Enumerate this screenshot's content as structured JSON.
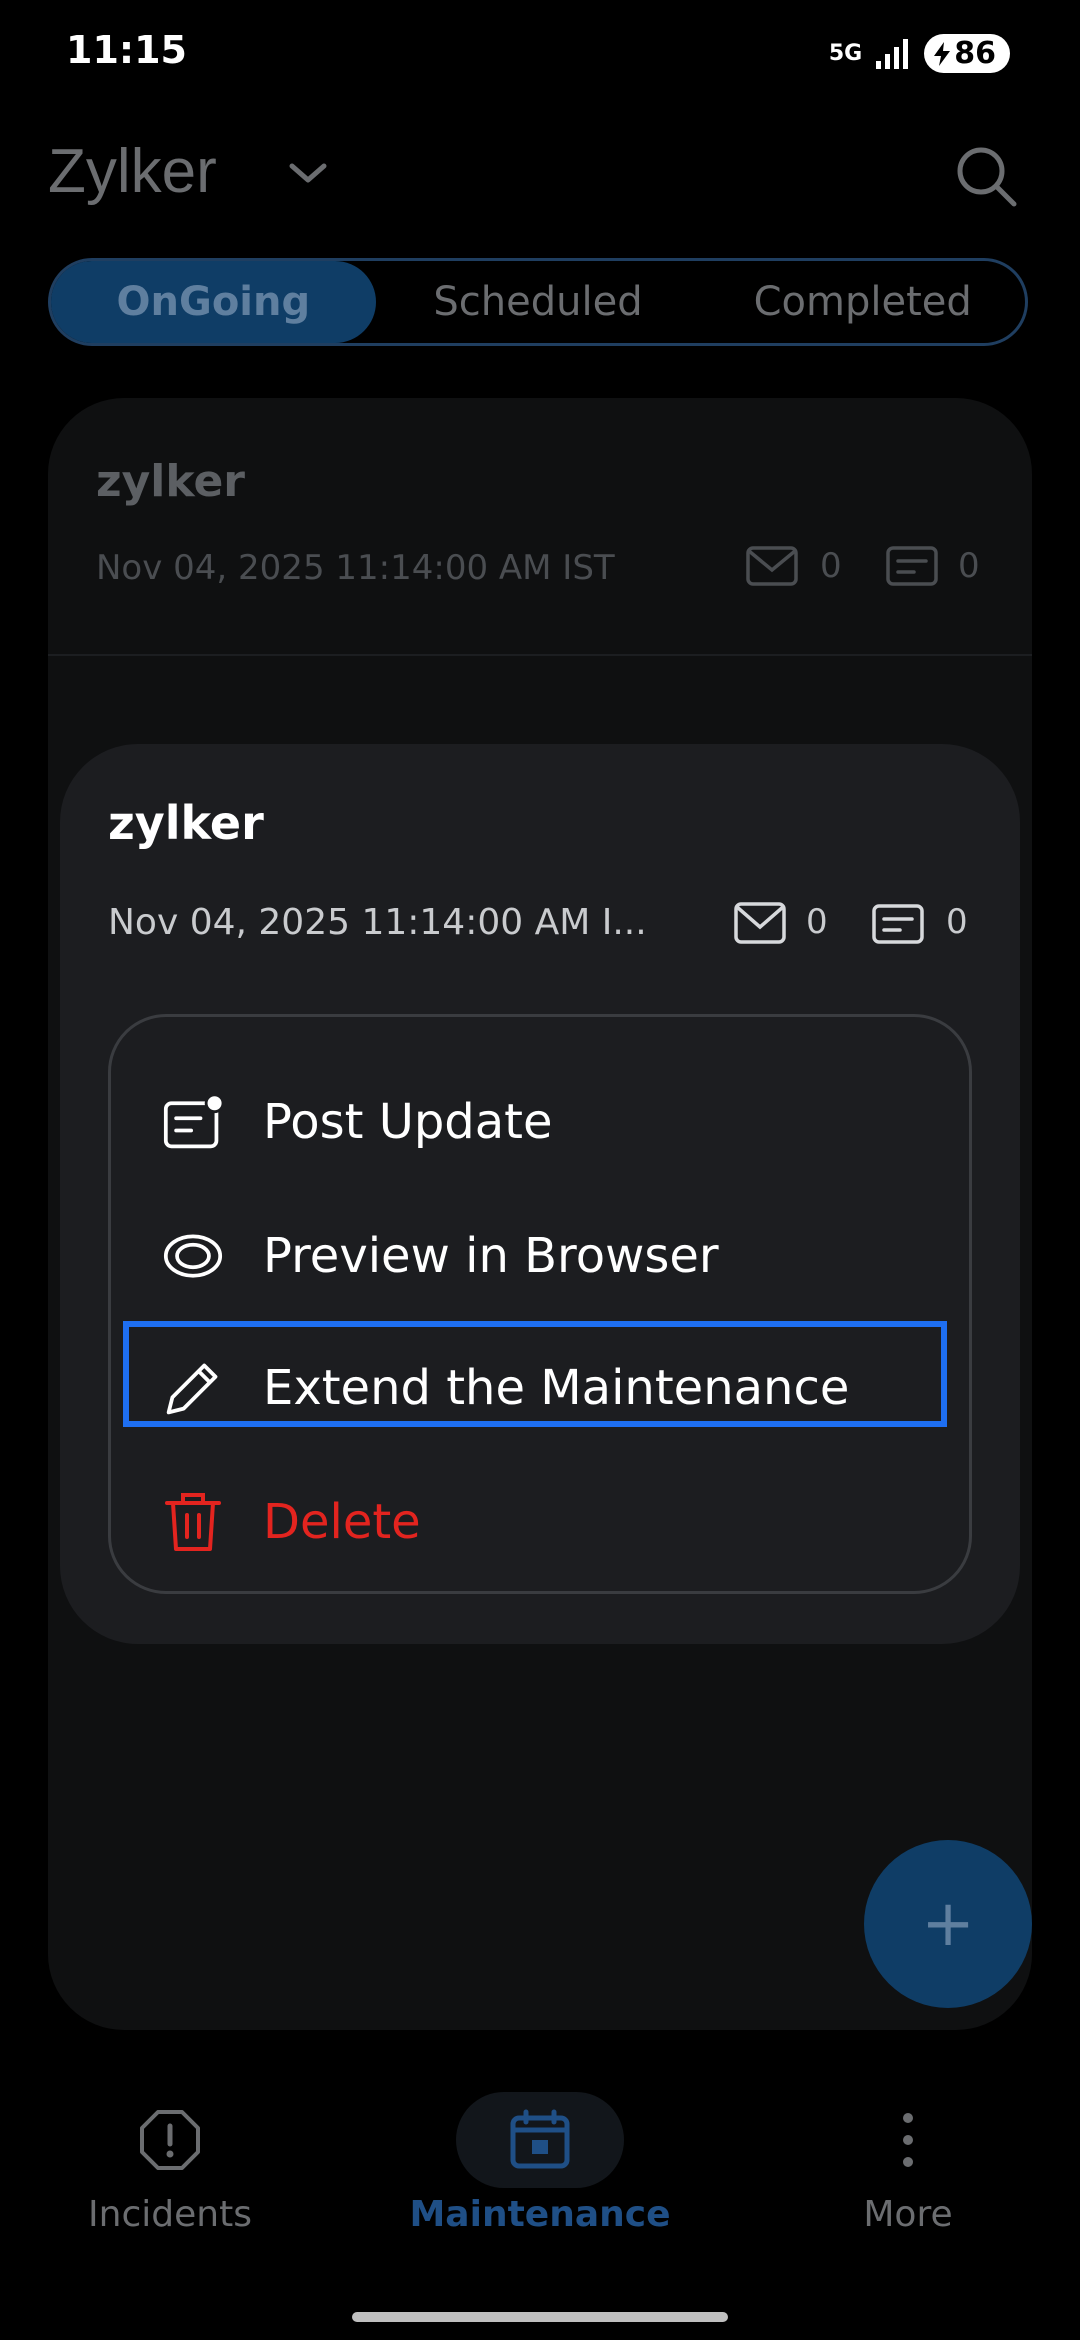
{
  "status_bar": {
    "time": "11:15",
    "network": "5G",
    "battery": "86"
  },
  "header": {
    "brand": "Zylker"
  },
  "tabs": [
    {
      "label": "OnGoing",
      "active": true
    },
    {
      "label": "Scheduled",
      "active": false
    },
    {
      "label": "Completed",
      "active": false
    }
  ],
  "list": {
    "rows": [
      {
        "title": "zylker",
        "date": "Nov 04, 2025 11:14:00 AM IST",
        "mail_count": "0",
        "update_count": "0"
      }
    ]
  },
  "focused_item": {
    "title": "zylker",
    "date": "Nov 04, 2025 11:14:00 AM I...",
    "mail_count": "0",
    "update_count": "0"
  },
  "menu": {
    "items": [
      {
        "label": "Post Update",
        "icon": "post-update-icon"
      },
      {
        "label": "Preview in Browser",
        "icon": "eye-icon"
      },
      {
        "label": "Extend the Maintenance",
        "icon": "pencil-icon",
        "highlighted": true
      },
      {
        "label": "Delete",
        "icon": "trash-icon",
        "destructive": true
      }
    ]
  },
  "fab": {
    "label": "+"
  },
  "bottom_nav": {
    "items": [
      {
        "label": "Incidents",
        "icon": "alert-circle-icon",
        "active": false
      },
      {
        "label": "Maintenance",
        "icon": "calendar-icon",
        "active": true
      },
      {
        "label": "More",
        "icon": "more-vertical-icon",
        "active": false
      }
    ]
  },
  "colors": {
    "accent": "#1e6ff2",
    "tab_active_bg": "#0f3d66",
    "destructive": "#e3241f",
    "background": "#000000"
  }
}
